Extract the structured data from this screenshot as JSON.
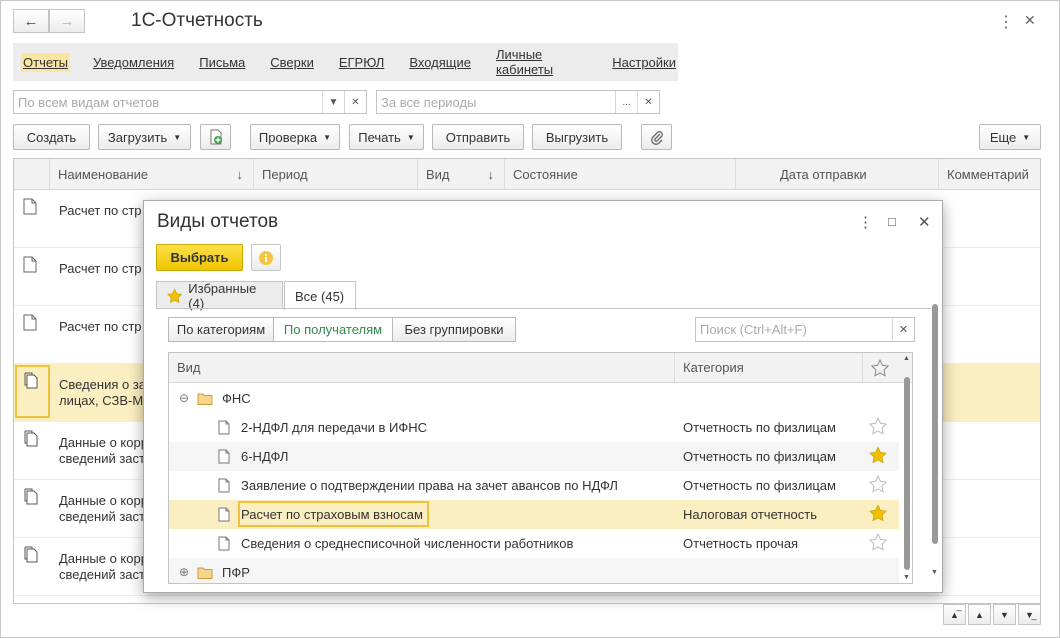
{
  "app": {
    "title": "1С-Отчетность"
  },
  "menu": {
    "items": [
      "Отчеты",
      "Уведомления",
      "Письма",
      "Сверки",
      "ЕГРЮЛ",
      "Входящие",
      "Личные кабинеты",
      "Настройки"
    ],
    "active": "Отчеты"
  },
  "filters": {
    "kind_placeholder": "По всем видам отчетов",
    "period_placeholder": "За все периоды"
  },
  "toolbar": {
    "create": "Создать",
    "load": "Загрузить",
    "check": "Проверка",
    "print": "Печать",
    "send": "Отправить",
    "export": "Выгрузить",
    "more": "Еще"
  },
  "table": {
    "columns": [
      "Наименование",
      "Период",
      "Вид",
      "Состояние",
      "Дата отправки",
      "Комментарий"
    ],
    "rows": [
      {
        "line1": "Расчет по стр",
        "line2": ""
      },
      {
        "line1": "Расчет по стр",
        "line2": ""
      },
      {
        "line1": "Расчет по стр",
        "line2": ""
      },
      {
        "line1": "Сведения о за",
        "line2": "лицах, СЗВ-М"
      },
      {
        "line1": "Данные о корр",
        "line2": "сведений заст"
      },
      {
        "line1": "Данные о корр",
        "line2": "сведений заст"
      },
      {
        "line1": "Данные о корр",
        "line2": "сведений заст"
      }
    ]
  },
  "dialog": {
    "title": "Виды отчетов",
    "select_button": "Выбрать",
    "tabs": [
      "Избранные (4)",
      "Все (45)"
    ],
    "groupings": [
      "По категориям",
      "По получателям",
      "Без группировки"
    ],
    "search_placeholder": "Поиск (Ctrl+Alt+F)",
    "columns": [
      "Вид",
      "Категория"
    ],
    "groups": [
      {
        "name": "ФНС",
        "items": [
          {
            "name": "2-НДФЛ для передачи в ИФНС",
            "category": "Отчетность по физлицам",
            "favorite": false
          },
          {
            "name": "6-НДФЛ",
            "category": "Отчетность по физлицам",
            "favorite": true
          },
          {
            "name": "Заявление о подтверждении права на зачет авансов по НДФЛ",
            "category": "Отчетность по физлицам",
            "favorite": false
          },
          {
            "name": "Расчет по страховым взносам",
            "category": "Налоговая отчетность",
            "favorite": true
          },
          {
            "name": "Сведения о среднесписочной численности работников",
            "category": "Отчетность прочая",
            "favorite": false
          }
        ]
      },
      {
        "name": "ПФР",
        "items": []
      }
    ]
  },
  "colors": {
    "accent_yellow": "#f0c400",
    "selection": "#fbeec0",
    "menu_active": "#fae6a1",
    "green_text": "#2d8a4a"
  }
}
